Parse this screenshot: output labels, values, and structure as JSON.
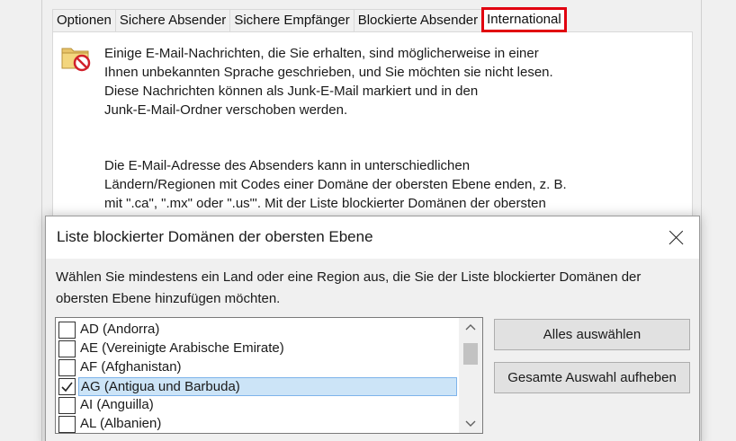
{
  "background_window": {
    "tabs": [
      {
        "label": "Optionen"
      },
      {
        "label": "Sichere Absender"
      },
      {
        "label": "Sichere Empfänger"
      },
      {
        "label": "Blockierte Absender"
      },
      {
        "label": "International"
      }
    ],
    "active_tab": "International",
    "paragraph1_lines": [
      "Einige E-Mail-Nachrichten, die Sie erhalten, sind möglicherweise in einer",
      "Ihnen unbekannten Sprache geschrieben, und Sie möchten sie nicht lesen.",
      "Diese Nachrichten können als Junk-E-Mail markiert und in den",
      "Junk-E-Mail-Ordner verschoben werden."
    ],
    "paragraph2_lines": [
      "Die E-Mail-Adresse des Absenders kann in unterschiedlichen",
      "Ländern/Regionen mit Codes einer Domäne der obersten Ebene enden, z. B.",
      "mit \".ca\", \".mx\" oder \".us\"'. Mit der Liste blockierter Domänen der obersten"
    ],
    "icon": "folder-blocked-icon"
  },
  "dialog": {
    "title": "Liste blockierter Domänen der obersten Ebene",
    "instruction_lines": [
      "Wählen Sie mindestens ein Land oder eine Region aus, die Sie der Liste blockierter Domänen der",
      "obersten Ebene hinzufügen möchten."
    ],
    "items": [
      {
        "label": "AD (Andorra)",
        "checked": false,
        "selected": false
      },
      {
        "label": "AE (Vereinigte Arabische Emirate)",
        "checked": false,
        "selected": false
      },
      {
        "label": "AF (Afghanistan)",
        "checked": false,
        "selected": false
      },
      {
        "label": "AG (Antigua und Barbuda)",
        "checked": true,
        "selected": true
      },
      {
        "label": "AI (Anguilla)",
        "checked": false,
        "selected": false
      },
      {
        "label": "AL (Albanien)",
        "checked": false,
        "selected": false
      }
    ],
    "buttons": {
      "select_all": "Alles auswählen",
      "clear_all": "Gesamte Auswahl aufheben"
    },
    "close_icon": "close-icon"
  }
}
